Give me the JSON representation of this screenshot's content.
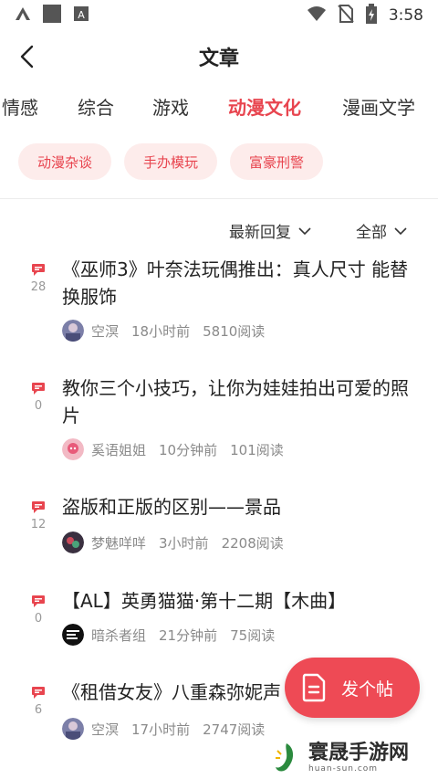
{
  "status_bar": {
    "time": "3:58"
  },
  "header": {
    "title": "文章"
  },
  "categories": [
    "情感",
    "综合",
    "游戏",
    "动漫文化",
    "漫画文学"
  ],
  "active_category": "动漫文化",
  "subtags": [
    "动漫杂谈",
    "手办模玩",
    "富豪刑警"
  ],
  "filters": {
    "sort": "最新回复",
    "scope": "全部"
  },
  "posts": [
    {
      "title": "《巫师3》叶奈法玩偶推出：真人尺寸 能替换服饰",
      "comments": "28",
      "author": "空溟",
      "time": "18小时前",
      "reads": "5810阅读"
    },
    {
      "title": "教你三个小技巧，让你为娃娃拍出可爱的照片",
      "comments": "0",
      "author": "奚语姐姐",
      "time": "10分钟前",
      "reads": "101阅读"
    },
    {
      "title": "盗版和正版的区别——景品",
      "comments": "12",
      "author": "梦魅咩咩",
      "time": "3小时前",
      "reads": "2208阅读"
    },
    {
      "title": "【AL】英勇猫猫·第十二期【木曲】",
      "comments": "0",
      "author": "暗杀者组",
      "time": "21分钟前",
      "reads": "75阅读"
    },
    {
      "title": "《租借女友》八重森弥妮声",
      "comments": "6",
      "author": "空溟",
      "time": "17小时前",
      "reads": "2747阅读"
    }
  ],
  "fab": {
    "label": "发个帖"
  },
  "watermark": {
    "text": "寰晟手游网",
    "sub": "huan-sun.com"
  },
  "colors": {
    "accent": "#e8454f",
    "tag_bg": "#fdeceb",
    "fab_bg": "#ee4a55"
  }
}
